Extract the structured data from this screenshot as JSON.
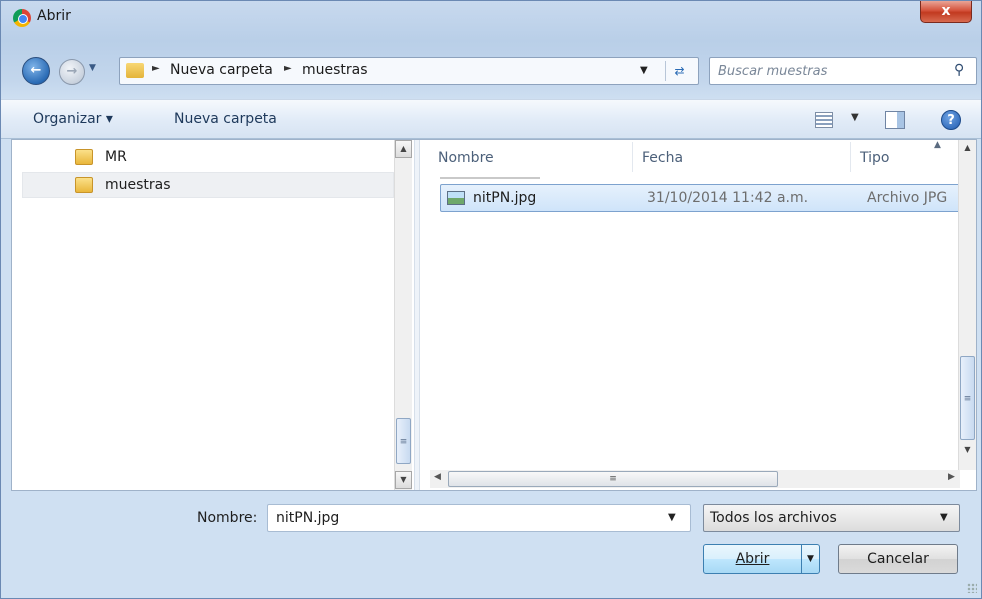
{
  "window": {
    "title": "Abrir",
    "close_label": "x"
  },
  "address": {
    "crumbs": [
      "Nueva carpeta",
      "muestras"
    ]
  },
  "search": {
    "placeholder": "Buscar muestras"
  },
  "toolbar": {
    "organize_label": "Organizar ▾",
    "new_folder_label": "Nueva carpeta"
  },
  "nav_pane": {
    "items": [
      {
        "label": "MR"
      },
      {
        "label": "muestras",
        "selected": true
      }
    ]
  },
  "file_list": {
    "columns": [
      "Nombre",
      "Fecha",
      "Tipo"
    ],
    "rows": [
      {
        "name": "nitPN.jpg",
        "date": "31/10/2014 11:42 a.m.",
        "type": "Archivo JPG"
      }
    ]
  },
  "bottom": {
    "filename_label": "Nombre:",
    "filename_value": "nitPN.jpg",
    "filetype_value": "Todos los archivos",
    "open_label": "Abrir",
    "cancel_label": "Cancelar"
  },
  "colors": {
    "accent": "#2a6bb5",
    "selection": "#cfe4fa",
    "close": "#c23a20"
  }
}
